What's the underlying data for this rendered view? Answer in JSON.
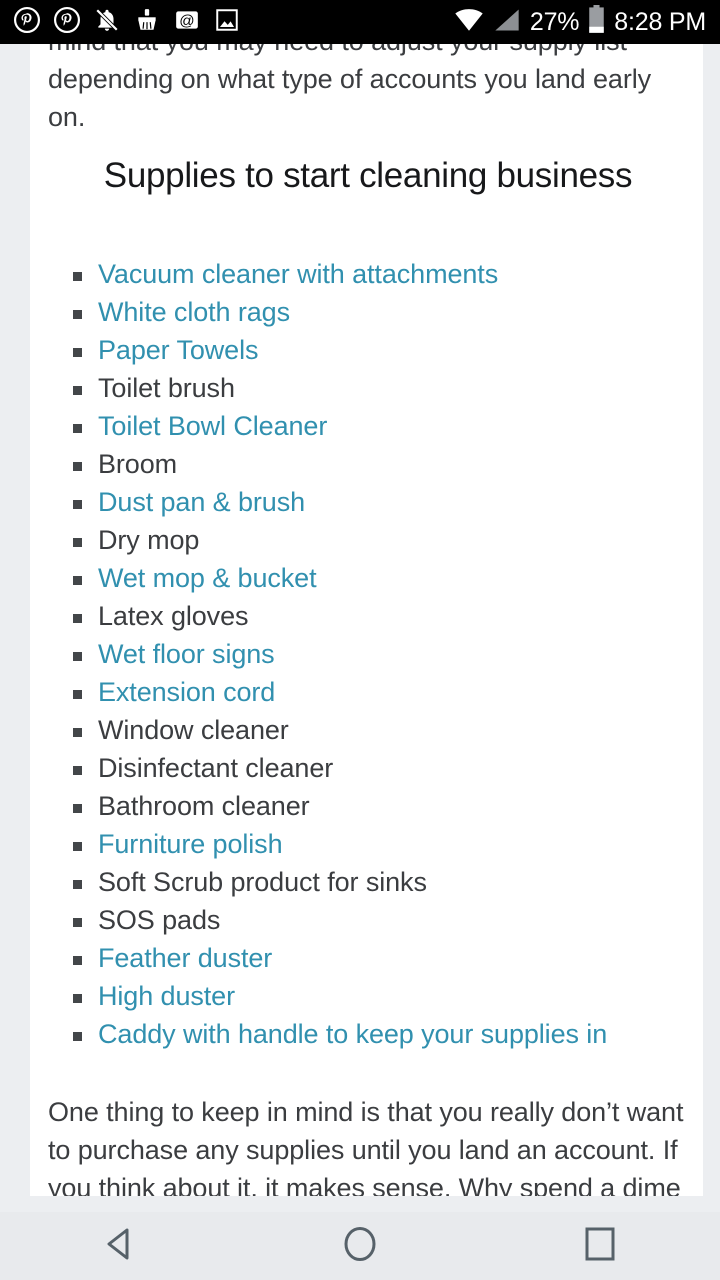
{
  "statusbar": {
    "icons_left": [
      {
        "name": "pinterest-icon",
        "glyph": "pinterest"
      },
      {
        "name": "pinterest-icon",
        "glyph": "pinterest"
      },
      {
        "name": "notifications-muted-icon",
        "glyph": "bell-slash"
      },
      {
        "name": "cleaning-app-icon",
        "glyph": "broom"
      },
      {
        "name": "email-icon",
        "glyph": "at-sign"
      },
      {
        "name": "screenshot-icon",
        "glyph": "image"
      }
    ],
    "icons_right": [
      {
        "name": "wifi-icon",
        "glyph": "wifi"
      },
      {
        "name": "cellular-signal-icon",
        "glyph": "signal"
      }
    ],
    "battery_percent": "27%",
    "battery_icon": "battery-low-icon",
    "clock": "8:28 PM"
  },
  "article": {
    "paragraph_top": "mind that you may need to adjust your supply list depending on what type of accounts you land early on.",
    "heading": "Supplies to start cleaning business",
    "supplies": [
      {
        "label": "Vacuum cleaner with attachments",
        "link": true
      },
      {
        "label": "White cloth rags",
        "link": true
      },
      {
        "label": "Paper Towels",
        "link": true
      },
      {
        "label": "Toilet brush",
        "link": false
      },
      {
        "label": "Toilet Bowl Cleaner",
        "link": true
      },
      {
        "label": "Broom",
        "link": false
      },
      {
        "label": "Dust pan & brush",
        "link": true
      },
      {
        "label": "Dry mop",
        "link": false
      },
      {
        "label": "Wet mop & bucket",
        "link": true
      },
      {
        "label": "Latex gloves",
        "link": false
      },
      {
        "label": "Wet floor signs",
        "link": true
      },
      {
        "label": "Extension cord",
        "link": true
      },
      {
        "label": "Window cleaner",
        "link": false
      },
      {
        "label": "Disinfectant cleaner",
        "link": false
      },
      {
        "label": "Bathroom cleaner",
        "link": false
      },
      {
        "label": "Furniture polish",
        "link": true
      },
      {
        "label": "Soft Scrub product for sinks",
        "link": false
      },
      {
        "label": "SOS pads",
        "link": false
      },
      {
        "label": "Feather duster",
        "link": true
      },
      {
        "label": "High duster",
        "link": true
      },
      {
        "label": "Caddy with handle to keep your supplies in",
        "link": true
      }
    ],
    "paragraph_bottom": "One thing to keep in mind is that you really don’t want to purchase any supplies until you land an account. If you think about it, it makes sense. Why spend a dime"
  },
  "navbar": {
    "buttons": [
      {
        "name": "back-button",
        "icon": "back-triangle-icon"
      },
      {
        "name": "home-button",
        "icon": "home-circle-icon"
      },
      {
        "name": "recents-button",
        "icon": "recents-square-icon"
      }
    ]
  },
  "colors": {
    "link": "#3190af",
    "text": "#3b3d40",
    "heading": "#17181a",
    "bullet": "#434649",
    "page_bg": "#eceef1",
    "article_bg": "#ffffff",
    "statusbar_bg": "#000000",
    "navbar_bg": "#e8eaed",
    "nav_icon": "#566169"
  }
}
